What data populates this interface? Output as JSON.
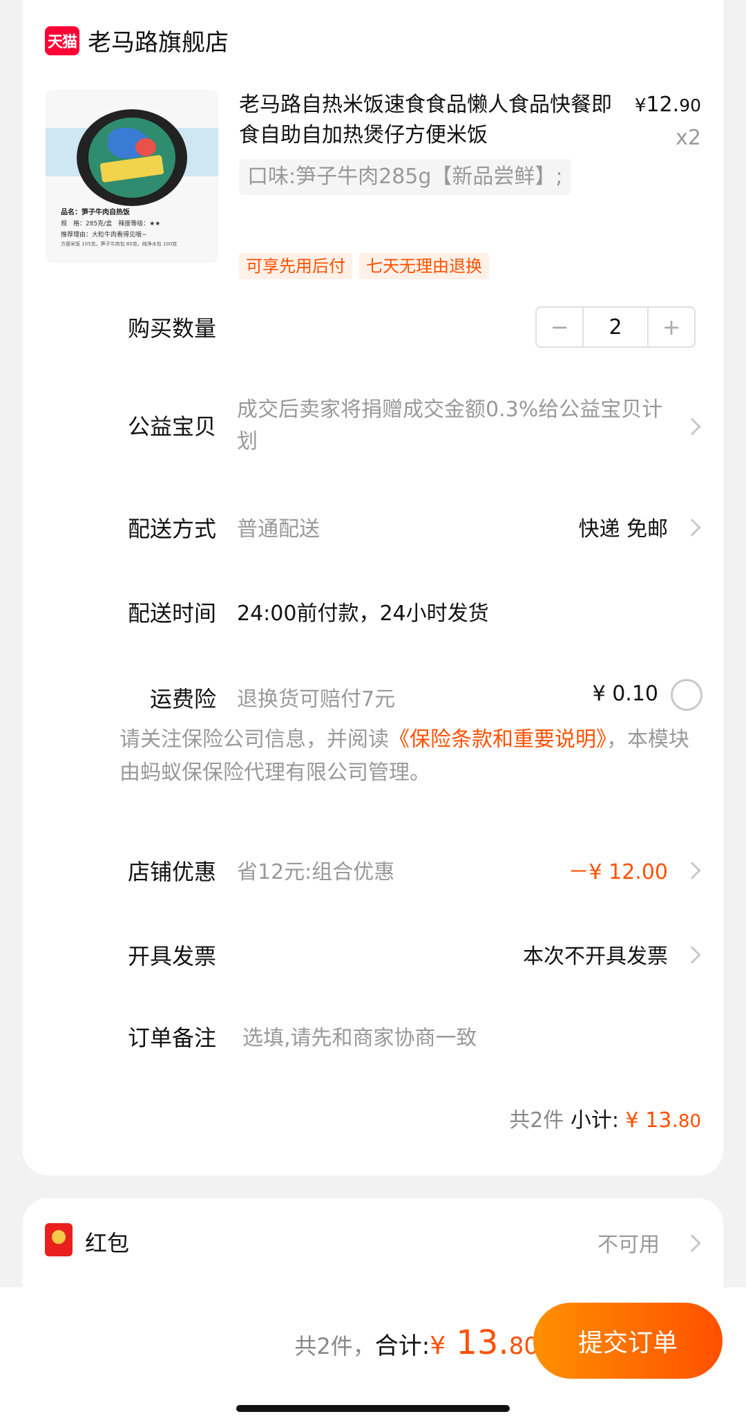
{
  "store": {
    "logo_text": "天猫",
    "name": "老马路旗舰店"
  },
  "product": {
    "title": "老马路自热米饭速食食品懒人食品快餐即食自助自加热煲仔方便米饭",
    "price_currency": "¥",
    "price_int": "12.",
    "price_dec": "90",
    "quantity_label": "x2",
    "sku": "口味:笋子牛肉285g【新品尝鲜】;",
    "tags": [
      "可享先用后付",
      "七天无理由退换"
    ],
    "thumb_text": {
      "line1": "品名：笋子牛肉自热饭",
      "line2": "规　格：285克/盒　辣度等级：★★",
      "line3": "推荐理由：大粒牛肉看得见哦~",
      "line4": "方便米饭 105克，笋子牛肉包 80克，纯净水包 100克"
    }
  },
  "rows": {
    "quantity": {
      "label": "购买数量",
      "minus": "−",
      "value": "2",
      "plus": "+"
    },
    "charity": {
      "label": "公益宝贝",
      "value": "成交后卖家将捐赠成交金额0.3%给公益宝贝计划"
    },
    "delivery": {
      "label": "配送方式",
      "value": "普通配送",
      "right": "快递 免邮"
    },
    "delivery_time": {
      "label": "配送时间",
      "value": "24:00前付款，24小时发货"
    },
    "insurance": {
      "label": "运费险",
      "value": "退换货可赔付7元",
      "right": "¥ 0.10"
    },
    "notice": {
      "prefix": "请关注保险公司信息，并阅读",
      "link": "《保险条款和重要说明》",
      "suffix": "，本模块由蚂蚁保保险代理有限公司管理。"
    },
    "discount": {
      "label": "店铺优惠",
      "value": "省12元:组合优惠",
      "right": "－¥ 12.00"
    },
    "invoice": {
      "label": "开具发票",
      "right": "本次不开具发票"
    },
    "remark": {
      "label": "订单备注",
      "placeholder": "选填,请先和商家协商一致"
    }
  },
  "subtotal": {
    "count": "共2件",
    "label": " 小计: ",
    "currency": "¥",
    "int": "13.",
    "dec": "80"
  },
  "red_packet": {
    "label": "红包",
    "status": "不可用"
  },
  "bottom": {
    "count": "共2件，",
    "label": "合计:",
    "currency": "¥",
    "int": "13.",
    "dec": "80",
    "submit": "提交订单"
  },
  "colors": {
    "accent": "#ff5000",
    "brand": "#ff0036"
  }
}
